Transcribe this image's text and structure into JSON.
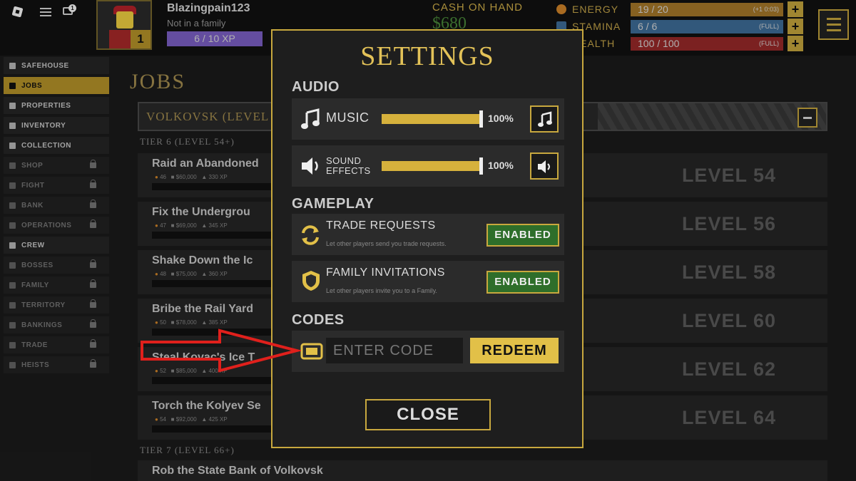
{
  "topbar": {
    "username": "Blazingpain123",
    "family_status": "Not in a family",
    "level": "1",
    "xp": "6 / 10 XP",
    "notification_count": "1",
    "cash_label": "CASH ON HAND",
    "cash_value": "$680",
    "energy": {
      "label": "ENERGY",
      "value": "19 / 20",
      "sub": "(+1 0:03)",
      "color": "#a87a2a"
    },
    "stamina": {
      "label": "STAMINA",
      "value": "6 / 6",
      "sub": "(FULL)",
      "color": "#3f6f9a"
    },
    "health": {
      "label": "HEALTH",
      "value": "100 / 100",
      "sub": "(FULL)",
      "color": "#9a2a2a"
    }
  },
  "sidebar": {
    "items": [
      {
        "label": "SAFEHOUSE",
        "state": "normal"
      },
      {
        "label": "JOBS",
        "state": "active"
      },
      {
        "label": "PROPERTIES",
        "state": "normal"
      },
      {
        "label": "INVENTORY",
        "state": "normal"
      },
      {
        "label": "COLLECTION",
        "state": "normal"
      },
      {
        "label": "SHOP",
        "state": "locked"
      },
      {
        "label": "FIGHT",
        "state": "locked"
      },
      {
        "label": "BANK",
        "state": "locked"
      },
      {
        "label": "OPERATIONS",
        "state": "locked"
      },
      {
        "label": "CREW",
        "state": "normal"
      },
      {
        "label": "BOSSES",
        "state": "locked"
      },
      {
        "label": "FAMILY",
        "state": "locked"
      },
      {
        "label": "TERRITORY",
        "state": "locked"
      },
      {
        "label": "BANKINGS",
        "state": "locked"
      },
      {
        "label": "TRADE",
        "state": "locked"
      },
      {
        "label": "HEISTS",
        "state": "locked"
      }
    ]
  },
  "main": {
    "title": "JOBS",
    "city": "VOLKOVSK (LEVEL",
    "tier6": "TIER 6 (LEVEL 54+)",
    "tier7": "TIER 7 (LEVEL 66+)",
    "jobs": [
      {
        "title": "Raid an Abandoned",
        "energy": "46",
        "cash": "$60,000",
        "xp": "330 XP",
        "level": "LEVEL 54"
      },
      {
        "title": "Fix the Undergrou",
        "energy": "47",
        "cash": "$69,000",
        "xp": "345 XP",
        "level": "LEVEL 56"
      },
      {
        "title": "Shake Down the Ic",
        "energy": "48",
        "cash": "$75,000",
        "xp": "360 XP",
        "level": "LEVEL 58"
      },
      {
        "title": "Bribe the Rail Yard",
        "energy": "50",
        "cash": "$78,000",
        "xp": "385 XP",
        "level": "LEVEL 60"
      },
      {
        "title": "Steal Kovac's Ice T",
        "energy": "52",
        "cash": "$85,000",
        "xp": "400 XP",
        "level": "LEVEL 62"
      },
      {
        "title": "Torch the Kolyev Se",
        "energy": "54",
        "cash": "$92,000",
        "xp": "425 XP",
        "level": "LEVEL 64"
      }
    ],
    "next_job": "Rob the State Bank of Volkovsk"
  },
  "settings": {
    "title": "SETTINGS",
    "audio_header": "AUDIO",
    "music_label": "MUSIC",
    "music_volume": 100,
    "music_pct": "100%",
    "sfx_label_1": "SOUND",
    "sfx_label_2": "EFFECTS",
    "sfx_volume": 100,
    "sfx_pct": "100%",
    "gameplay_header": "GAMEPLAY",
    "trade_label": "TRADE REQUESTS",
    "trade_desc": "Let other players send you trade requests.",
    "trade_status": "ENABLED",
    "family_label": "FAMILY INVITATIONS",
    "family_desc": "Let other players invite you to a Family.",
    "family_status": "ENABLED",
    "codes_header": "CODES",
    "code_placeholder": "ENTER CODE",
    "redeem_label": "REDEEM",
    "close_label": "CLOSE"
  },
  "colors": {
    "gold": "#c8a83e",
    "enabled_green": "#2e6e2a",
    "arrow_red": "#e0201c"
  }
}
